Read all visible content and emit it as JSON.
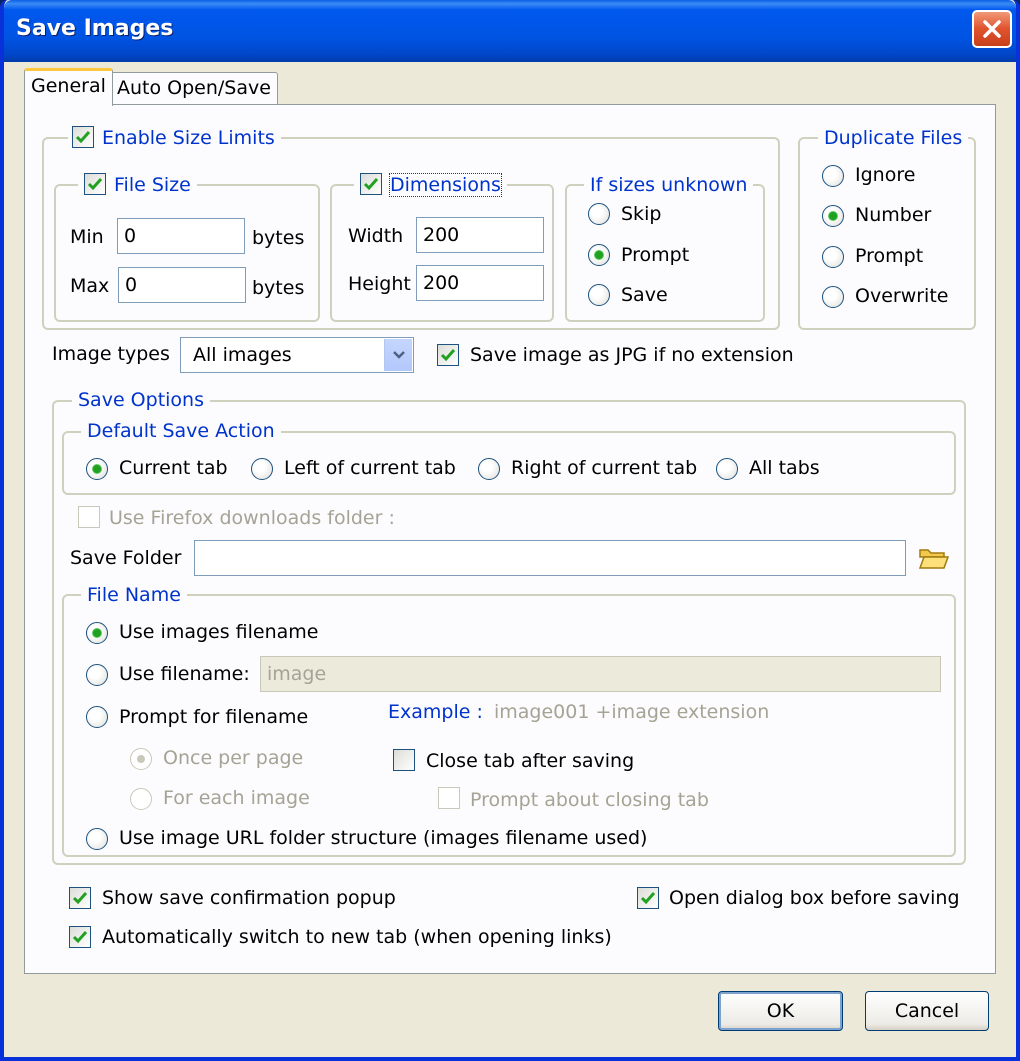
{
  "window": {
    "title": "Save Images"
  },
  "tabs": [
    {
      "label": "General",
      "active": true
    },
    {
      "label": "Auto Open/Save",
      "active": false
    }
  ],
  "size_limits": {
    "enable_label": "Enable Size Limits",
    "file_size": {
      "label": "File Size",
      "min_label": "Min",
      "min_value": "0",
      "min_unit": "bytes",
      "max_label": "Max",
      "max_value": "0",
      "max_unit": "bytes"
    },
    "dimensions": {
      "label": "Dimensions",
      "width_label": "Width",
      "width_value": "200",
      "height_label": "Height",
      "height_value": "200"
    },
    "unknown": {
      "label": "If sizes unknown",
      "options": [
        "Skip",
        "Prompt",
        "Save"
      ],
      "selected": "Prompt"
    }
  },
  "duplicate": {
    "label": "Duplicate Files",
    "options": [
      "Ignore",
      "Number",
      "Prompt",
      "Overwrite"
    ],
    "selected": "Number"
  },
  "image_types": {
    "label": "Image types",
    "value": "All images"
  },
  "save_jpg_label": "Save image as JPG if no extension",
  "save_options": {
    "label": "Save Options",
    "default_action": {
      "label": "Default Save Action",
      "options": [
        "Current tab",
        "Left of current tab",
        "Right of current tab",
        "All tabs"
      ],
      "selected": "Current tab"
    },
    "use_firefox_label": "Use Firefox downloads folder :",
    "save_folder_label": "Save Folder",
    "save_folder_value": "",
    "file_name": {
      "label": "File Name",
      "use_images_filename": "Use images filename",
      "use_filename": "Use filename:",
      "use_filename_value": "image",
      "prompt_for_filename": "Prompt for filename",
      "example_label": "Example :",
      "example_value": "image001 +image extension",
      "once_per_page": "Once per page",
      "for_each_image": "For each image",
      "close_tab": "Close tab after saving",
      "prompt_closing": "Prompt about closing tab",
      "url_structure": "Use image URL folder structure (images filename used)"
    }
  },
  "bottom": {
    "show_confirmation": "Show save confirmation popup",
    "auto_switch": "Automatically switch to new tab (when opening links)",
    "open_dialog": "Open dialog box before saving"
  },
  "buttons": {
    "ok": "OK",
    "cancel": "Cancel"
  },
  "colors": {
    "title_bar": "#0054e3",
    "group_label": "#0033cc",
    "check": "#21a121"
  },
  "icons": {
    "close": "close-icon",
    "folder": "folder-icon",
    "dropdown": "chevron-down-icon"
  }
}
